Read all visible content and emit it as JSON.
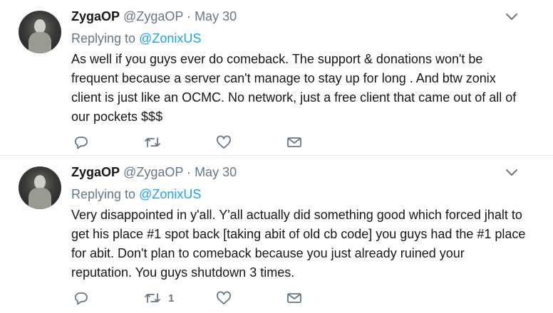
{
  "tweets": [
    {
      "name": "ZygaOP",
      "handle": "@ZygaOP",
      "separator": "·",
      "time": "May 30",
      "replying_prefix": "Replying to",
      "replying_to": "@ZonixUS",
      "text": "As well if you guys ever do comeback. The support & donations  won't be frequent because a server can't manage to stay up for long . And btw zonix client is just like an OCMC. No network, just a free client that came out of all of our pockets $$$",
      "retweet_count": ""
    },
    {
      "name": "ZygaOP",
      "handle": "@ZygaOP",
      "separator": "·",
      "time": "May 30",
      "replying_prefix": "Replying to",
      "replying_to": "@ZonixUS",
      "text": "Very disappointed in y'all. Y'all actually did something good which  forced jhalt to get his place #1 spot back [taking abit of old cb code] you guys had the #1 place for abit. Don't plan to comeback because you just already ruined your reputation. You guys shutdown 3 times.",
      "retweet_count": "1"
    }
  ],
  "icons": {
    "reply": "reply-icon",
    "retweet": "retweet-icon",
    "like": "heart-icon",
    "message": "envelope-icon",
    "more": "chevron-down-icon"
  },
  "colors": {
    "link": "#1da1f2",
    "muted": "#657786",
    "text": "#14171a",
    "divider": "#e6ecf0"
  }
}
